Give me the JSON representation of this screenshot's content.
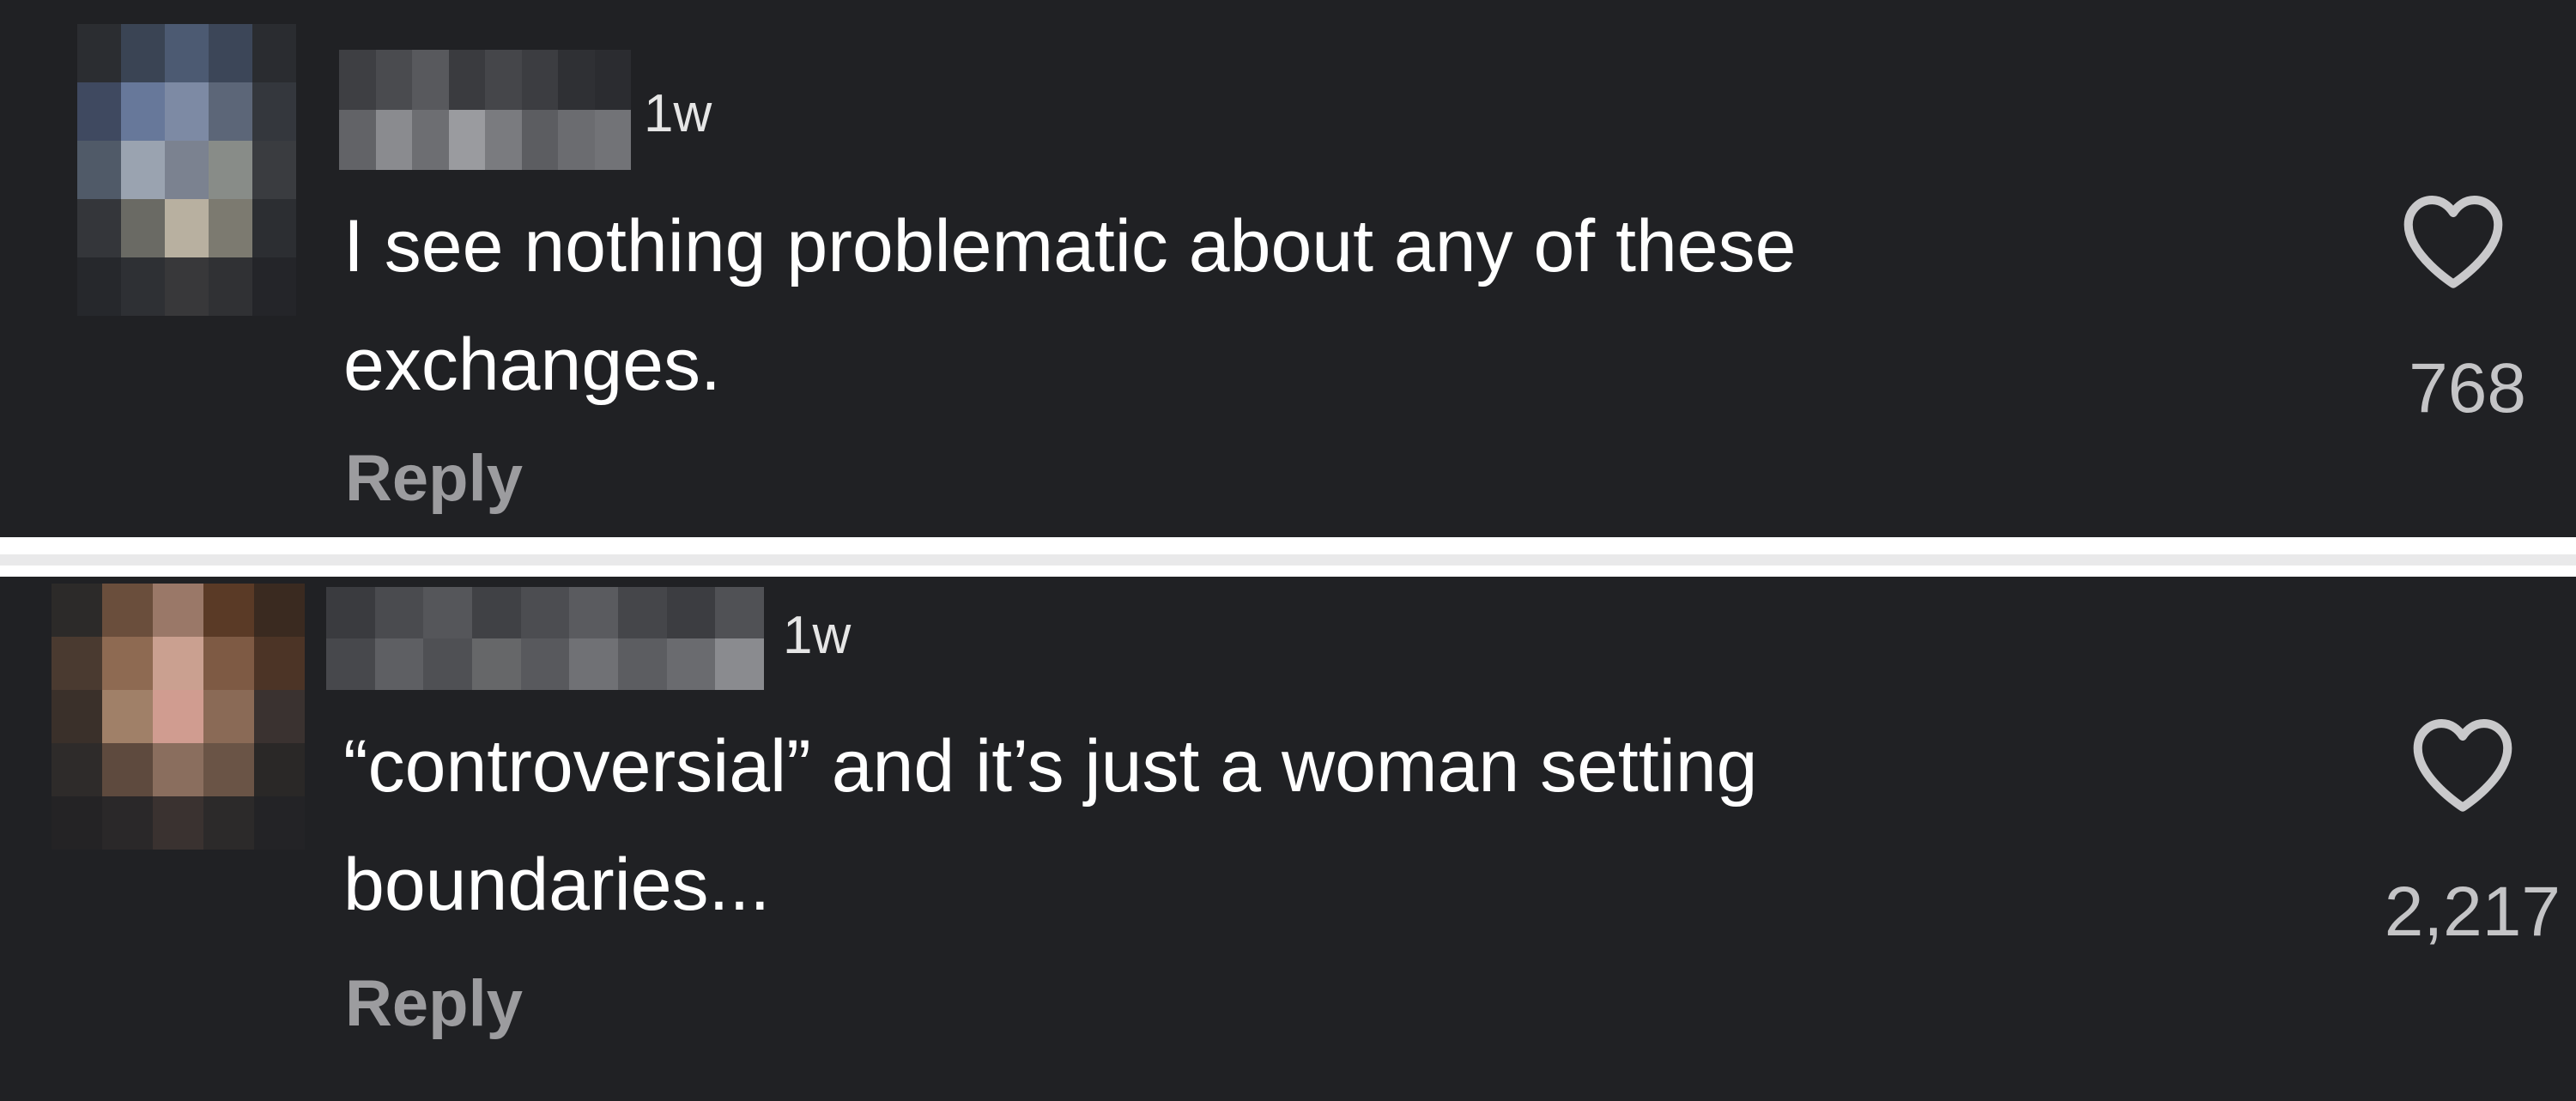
{
  "comments": [
    {
      "timestamp": "1w",
      "text_lines": [
        "I see nothing problematic about any of these",
        "exchanges."
      ],
      "reply_label": "Reply",
      "like_count": "768",
      "avatar_colors": [
        "#2b2d31",
        "#3a4454",
        "#4c5a72",
        "#3c4658",
        "#2a2c30",
        "#3f4960",
        "#67789a",
        "#7d8aa4",
        "#5c6678",
        "#34373d",
        "#505a68",
        "#9aa3b0",
        "#7b8290",
        "#888c88",
        "#3a3c40",
        "#34363a",
        "#6a6a64",
        "#b8b0a0",
        "#7c7a70",
        "#2c2e32",
        "#26282c",
        "#2e3034",
        "#38383a",
        "#303134",
        "#242529"
      ],
      "username_colors": [
        "#3e3f43",
        "#4a4b4f",
        "#58595d",
        "#3a3b3f",
        "#45464a",
        "#3c3d41",
        "#2f3034",
        "#2b2c30",
        "#626367",
        "#8a8b8f",
        "#6d6e72",
        "#9a9b9f",
        "#7a7b7f",
        "#5c5d61",
        "#6b6c70",
        "#727377"
      ]
    },
    {
      "timestamp": "1w",
      "text_lines": [
        "“controversial” and it’s just a woman setting",
        "boundaries..."
      ],
      "reply_label": "Reply",
      "like_count": "2,217",
      "avatar_colors": [
        "#2c2a29",
        "#6a4e3c",
        "#9a7868",
        "#5a3a26",
        "#3a2a20",
        "#4a3a30",
        "#8e6a52",
        "#caa090",
        "#7e5a44",
        "#4c3426",
        "#3a302a",
        "#a08068",
        "#d09c90",
        "#8a6a56",
        "#3a3230",
        "#2e2b2a",
        "#5e4a3e",
        "#8a6e5e",
        "#6a5446",
        "#2a2827",
        "#242325",
        "#2a2829",
        "#3a3230",
        "#2c2a2a",
        "#232326"
      ],
      "username_colors": [
        "#3a3b3f",
        "#4a4b4f",
        "#55565a",
        "#404145",
        "#4c4d51",
        "#5a5b5f",
        "#45464a",
        "#3c3d41",
        "#505155",
        "#47484c",
        "#5e5f63",
        "#4f5054",
        "#666769",
        "#58595d",
        "#707175",
        "#5c5d61",
        "#6a6b6f",
        "#8a8b8f"
      ]
    }
  ],
  "colors": {
    "card_background": "#202124",
    "page_background": "#ffffff",
    "text_primary": "#ffffff",
    "text_secondary": "#9c9c9f",
    "heart_stroke": "#c9c9cb"
  }
}
